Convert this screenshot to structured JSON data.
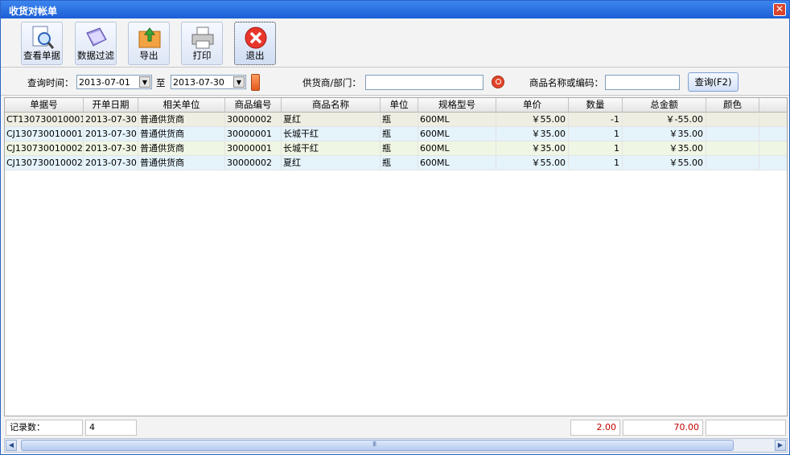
{
  "window": {
    "title": "收货对帐单",
    "close_glyph": "✕"
  },
  "toolbar": {
    "buttons": [
      {
        "label": "查看单据",
        "icon": "view-document-icon"
      },
      {
        "label": "数据过滤",
        "icon": "filter-icon"
      },
      {
        "label": "导出",
        "icon": "export-icon"
      },
      {
        "label": "打印",
        "icon": "printer-icon"
      },
      {
        "label": "退出",
        "icon": "exit-icon"
      }
    ]
  },
  "query": {
    "time_label": "查询时间：",
    "date_from": "2013-07-01",
    "to_label": "至",
    "date_to": "2013-07-30",
    "supplier_label": "供货商/部门：",
    "supplier_value": "",
    "product_label": "商品名称或编码：",
    "product_value": "",
    "search_button": "查询(F2)"
  },
  "table": {
    "columns": [
      "单据号",
      "开单日期",
      "相关单位",
      "商品编号",
      "商品名称",
      "单位",
      "规格型号",
      "单价",
      "数量",
      "总金额",
      "颜色"
    ],
    "rows": [
      [
        "CT130730010001",
        "2013-07-30",
        "普通供货商",
        "30000002",
        "夏红",
        "瓶",
        "600ML",
        "￥55.00",
        "-1",
        "￥-55.00",
        ""
      ],
      [
        "CJ130730010001",
        "2013-07-30",
        "普通供货商",
        "30000001",
        "长城干红",
        "瓶",
        "600ML",
        "￥35.00",
        "1",
        "￥35.00",
        ""
      ],
      [
        "CJ130730010002",
        "2013-07-30",
        "普通供货商",
        "30000001",
        "长城干红",
        "瓶",
        "600ML",
        "￥35.00",
        "1",
        "￥35.00",
        ""
      ],
      [
        "CJ130730010002",
        "2013-07-30",
        "普通供货商",
        "30000002",
        "夏红",
        "瓶",
        "600ML",
        "￥55.00",
        "1",
        "￥55.00",
        ""
      ]
    ]
  },
  "footer": {
    "record_label": "记录数：",
    "record_count": "4",
    "total_quantity": "2.00",
    "total_amount": "70.00"
  },
  "colors": {
    "title_bar": "#1d5ed6",
    "row_colors": [
      "#efeee2",
      "#e5f3fb",
      "#eff6e4",
      "#e5f3fb"
    ],
    "totals_text": "#c00000"
  }
}
